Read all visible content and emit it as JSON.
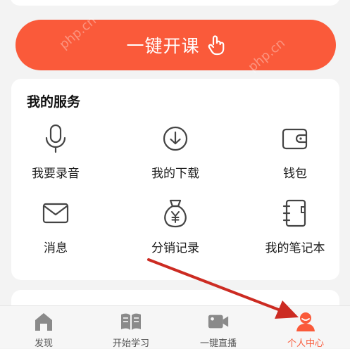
{
  "start_button": {
    "label": "一键开课",
    "icon": "tap-hand-icon"
  },
  "services": {
    "title": "我的服务",
    "items": [
      {
        "label": "我要录音",
        "icon": "microphone-icon"
      },
      {
        "label": "我的下载",
        "icon": "download-icon"
      },
      {
        "label": "钱包",
        "icon": "wallet-icon"
      },
      {
        "label": "消息",
        "icon": "mail-icon"
      },
      {
        "label": "分销记录",
        "icon": "money-bag-icon"
      },
      {
        "label": "我的笔记本",
        "icon": "notebook-icon"
      }
    ]
  },
  "tabbar": {
    "tabs": [
      {
        "label": "发现",
        "icon": "house-icon",
        "active": false
      },
      {
        "label": "开始学习",
        "icon": "open-book-icon",
        "active": false
      },
      {
        "label": "一键直播",
        "icon": "video-camera-icon",
        "active": false
      },
      {
        "label": "个人中心",
        "icon": "person-icon",
        "active": true
      }
    ]
  },
  "colors": {
    "accent": "#fa5a3a",
    "arrow": "#cc2b22",
    "icon": "#444444",
    "tab_icon": "#8a8a8a"
  }
}
